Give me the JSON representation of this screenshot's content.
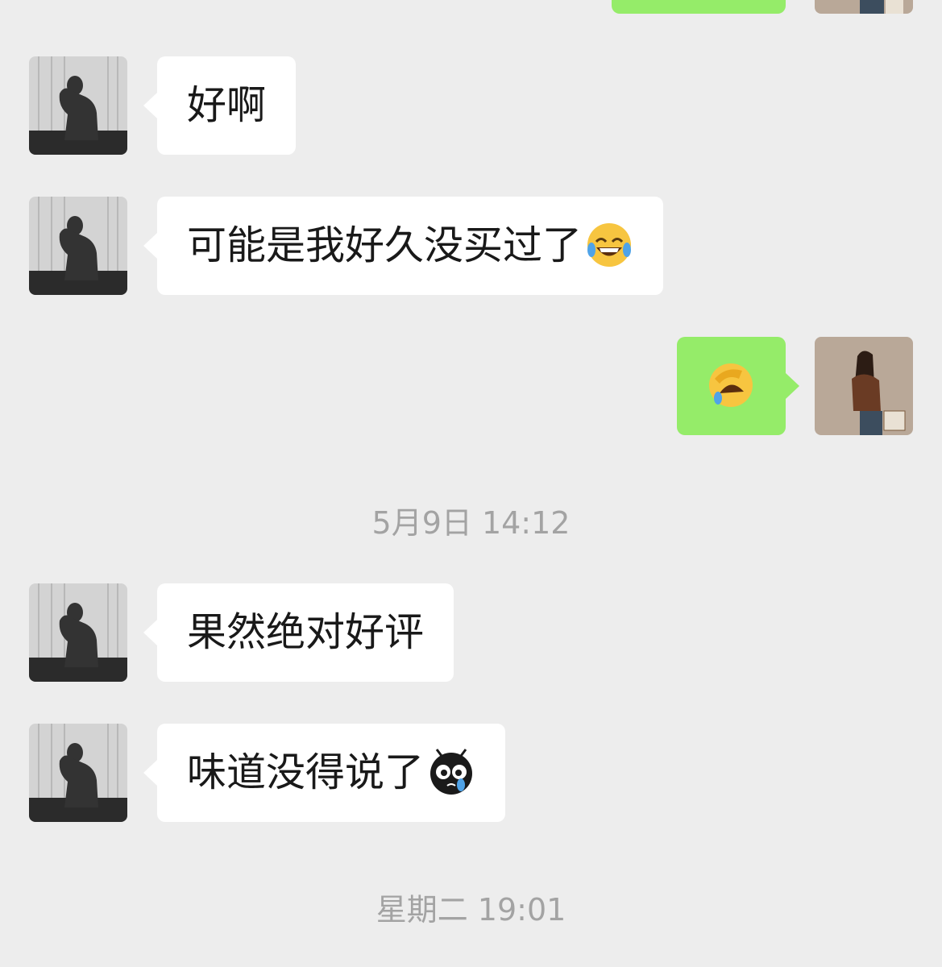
{
  "chat": {
    "messages": [
      {
        "id": "m1",
        "side": "incoming",
        "text": "好啊",
        "emoji": ""
      },
      {
        "id": "m2",
        "side": "incoming",
        "text": "可能是我好久没买过了",
        "emoji": "face-with-tears-of-joy"
      },
      {
        "id": "m3",
        "side": "outgoing",
        "text": "",
        "emoji": "rolling-on-floor-laughing"
      },
      {
        "id": "m4",
        "side": "incoming",
        "text": "果然绝对好评",
        "emoji": ""
      },
      {
        "id": "m5",
        "side": "incoming",
        "text": "味道没得说了",
        "emoji": "crying-bug-eyes"
      }
    ],
    "timestamps": [
      "5月9日 14:12",
      "星期二 19:01"
    ]
  },
  "colors": {
    "background": "#ededed",
    "incoming_bubble": "#ffffff",
    "outgoing_bubble": "#95ec69",
    "timestamp_text": "#a3a3a3"
  }
}
